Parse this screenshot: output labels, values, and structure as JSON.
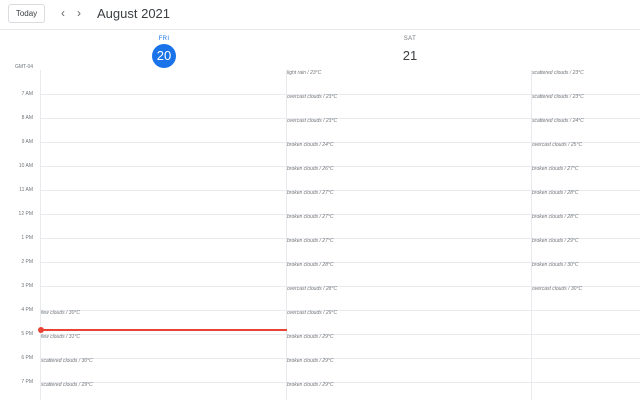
{
  "toolbar": {
    "today_label": "Today",
    "prev_icon": "‹",
    "next_icon": "›",
    "month_title": "August 2021"
  },
  "days": [
    {
      "dow": "FRI",
      "date": "20",
      "is_today": true
    },
    {
      "dow": "SAT",
      "date": "21",
      "is_today": false
    }
  ],
  "timezone": "GMT-04",
  "hours": [
    "7 AM",
    "8 AM",
    "9 AM",
    "10 AM",
    "11 AM",
    "12 PM",
    "1 PM",
    "2 PM",
    "3 PM",
    "4 PM",
    "5 PM",
    "6 PM",
    "7 PM"
  ],
  "columns": [
    {
      "events": [
        {
          "slot": 10,
          "text": "few clouds / 30°C"
        },
        {
          "slot": 11,
          "text": "few clouds / 31°C"
        },
        {
          "slot": 12,
          "text": "scattered clouds / 30°C"
        },
        {
          "slot": 13,
          "text": "scattered clouds / 29°C"
        }
      ]
    },
    {
      "events": [
        {
          "slot": 0,
          "text": "light rain / 23°C"
        },
        {
          "slot": 1,
          "text": "overcast clouds / 23°C"
        },
        {
          "slot": 2,
          "text": "overcast clouds / 23°C"
        },
        {
          "slot": 3,
          "text": "broken clouds / 24°C"
        },
        {
          "slot": 4,
          "text": "broken clouds / 26°C"
        },
        {
          "slot": 5,
          "text": "broken clouds / 27°C"
        },
        {
          "slot": 6,
          "text": "broken clouds / 27°C"
        },
        {
          "slot": 7,
          "text": "broken clouds / 27°C"
        },
        {
          "slot": 8,
          "text": "broken clouds / 28°C"
        },
        {
          "slot": 9,
          "text": "overcast clouds / 28°C"
        },
        {
          "slot": 10,
          "text": "overcast clouds / 29°C"
        },
        {
          "slot": 11,
          "text": "broken clouds / 29°C"
        },
        {
          "slot": 12,
          "text": "broken clouds / 29°C"
        },
        {
          "slot": 13,
          "text": "broken clouds / 29°C"
        }
      ]
    },
    {
      "events": [
        {
          "slot": 0,
          "text": "scattered clouds / 23°C"
        },
        {
          "slot": 1,
          "text": "scattered clouds / 23°C"
        },
        {
          "slot": 2,
          "text": "scattered clouds / 24°C"
        },
        {
          "slot": 3,
          "text": "overcast clouds / 25°C"
        },
        {
          "slot": 4,
          "text": "broken clouds / 27°C"
        },
        {
          "slot": 5,
          "text": "broken clouds / 28°C"
        },
        {
          "slot": 6,
          "text": "broken clouds / 28°C"
        },
        {
          "slot": 7,
          "text": "broken clouds / 29°C"
        },
        {
          "slot": 8,
          "text": "broken clouds / 30°C"
        },
        {
          "slot": 9,
          "text": "overcast clouds / 30°C"
        }
      ]
    }
  ],
  "colors": {
    "accent": "#1a73e8",
    "now_indicator": "#ea4335",
    "grid_line": "#e8eaed",
    "muted_text": "#70757a"
  }
}
